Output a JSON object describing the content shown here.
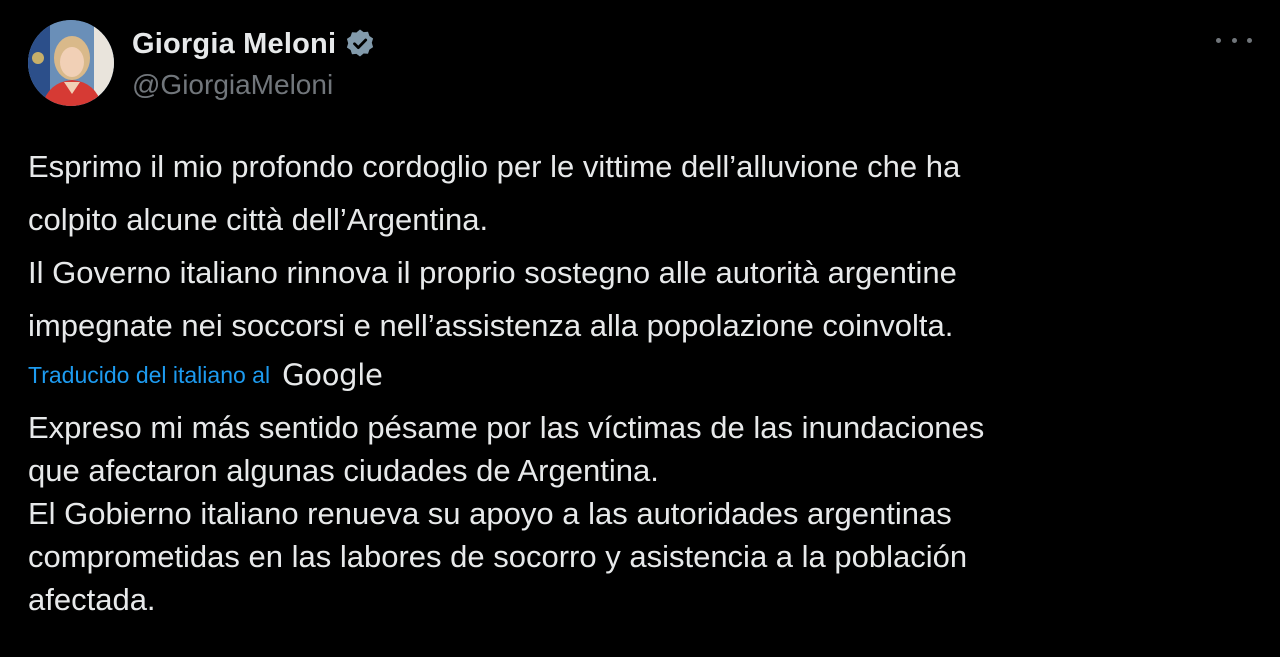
{
  "author": {
    "display_name": "Giorgia Meloni",
    "handle": "@GiorgiaMeloni",
    "verified": true,
    "avatar_icon": "profile-photo-icon",
    "badge_icon": "verified-badge-icon"
  },
  "menu": {
    "more_icon": "more-horizontal-icon"
  },
  "tweet": {
    "original_text": "Esprimo il mio profondo cordoglio per le vittime dell’alluvione che ha\ncolpito alcune città dell’Argentina.\nIl Governo italiano rinnova il proprio sostegno alle autorità argentine\nimpegnate nei soccorsi e nell’assistenza alla popolazione coinvolta.",
    "translation_label": "Traducido del italiano al",
    "translation_provider": "Google",
    "translated_text": "Expreso mi más sentido pésame por las víctimas de las inundaciones\nque afectaron algunas ciudades de Argentina.\nEl Gobierno italiano renueva su apoyo a las autoridades argentinas\ncomprometidas en las labores de socorro y asistencia a la población\nafectada."
  },
  "colors": {
    "background": "#000000",
    "text_primary": "#e7e9ea",
    "text_secondary": "#71767b",
    "link": "#1d9bf0"
  }
}
